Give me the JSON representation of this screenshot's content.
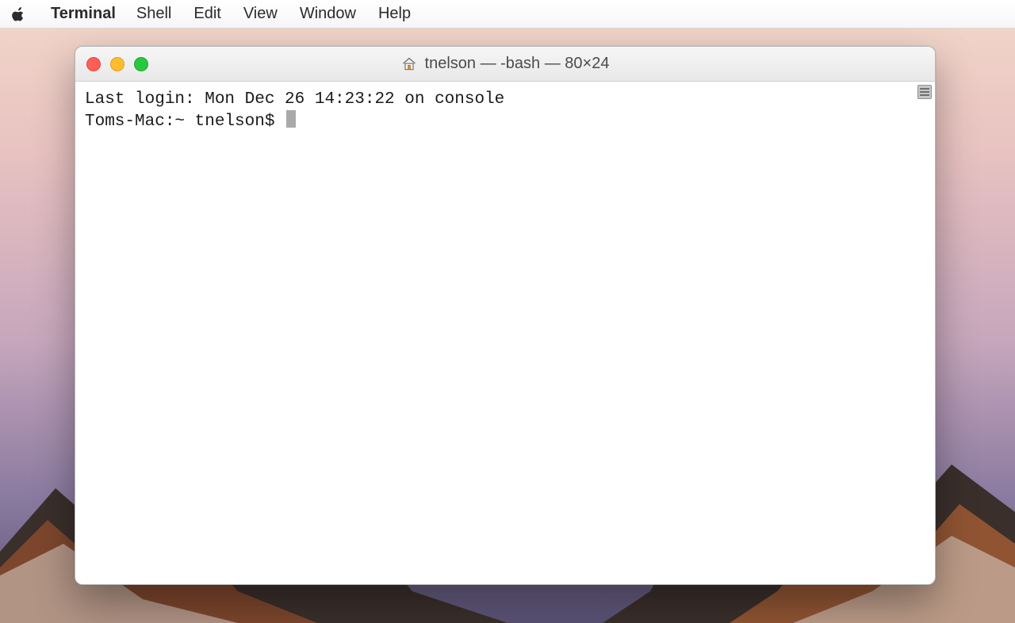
{
  "menubar": {
    "app_name": "Terminal",
    "items": [
      "Shell",
      "Edit",
      "View",
      "Window",
      "Help"
    ]
  },
  "window": {
    "title": "tnelson — -bash — 80×24",
    "traffic": {
      "close": "close",
      "minimize": "minimize",
      "zoom": "zoom"
    }
  },
  "terminal": {
    "line_login": "Last login: Mon Dec 26 14:23:22 on console",
    "prompt": "Toms-Mac:~ tnelson$ "
  }
}
